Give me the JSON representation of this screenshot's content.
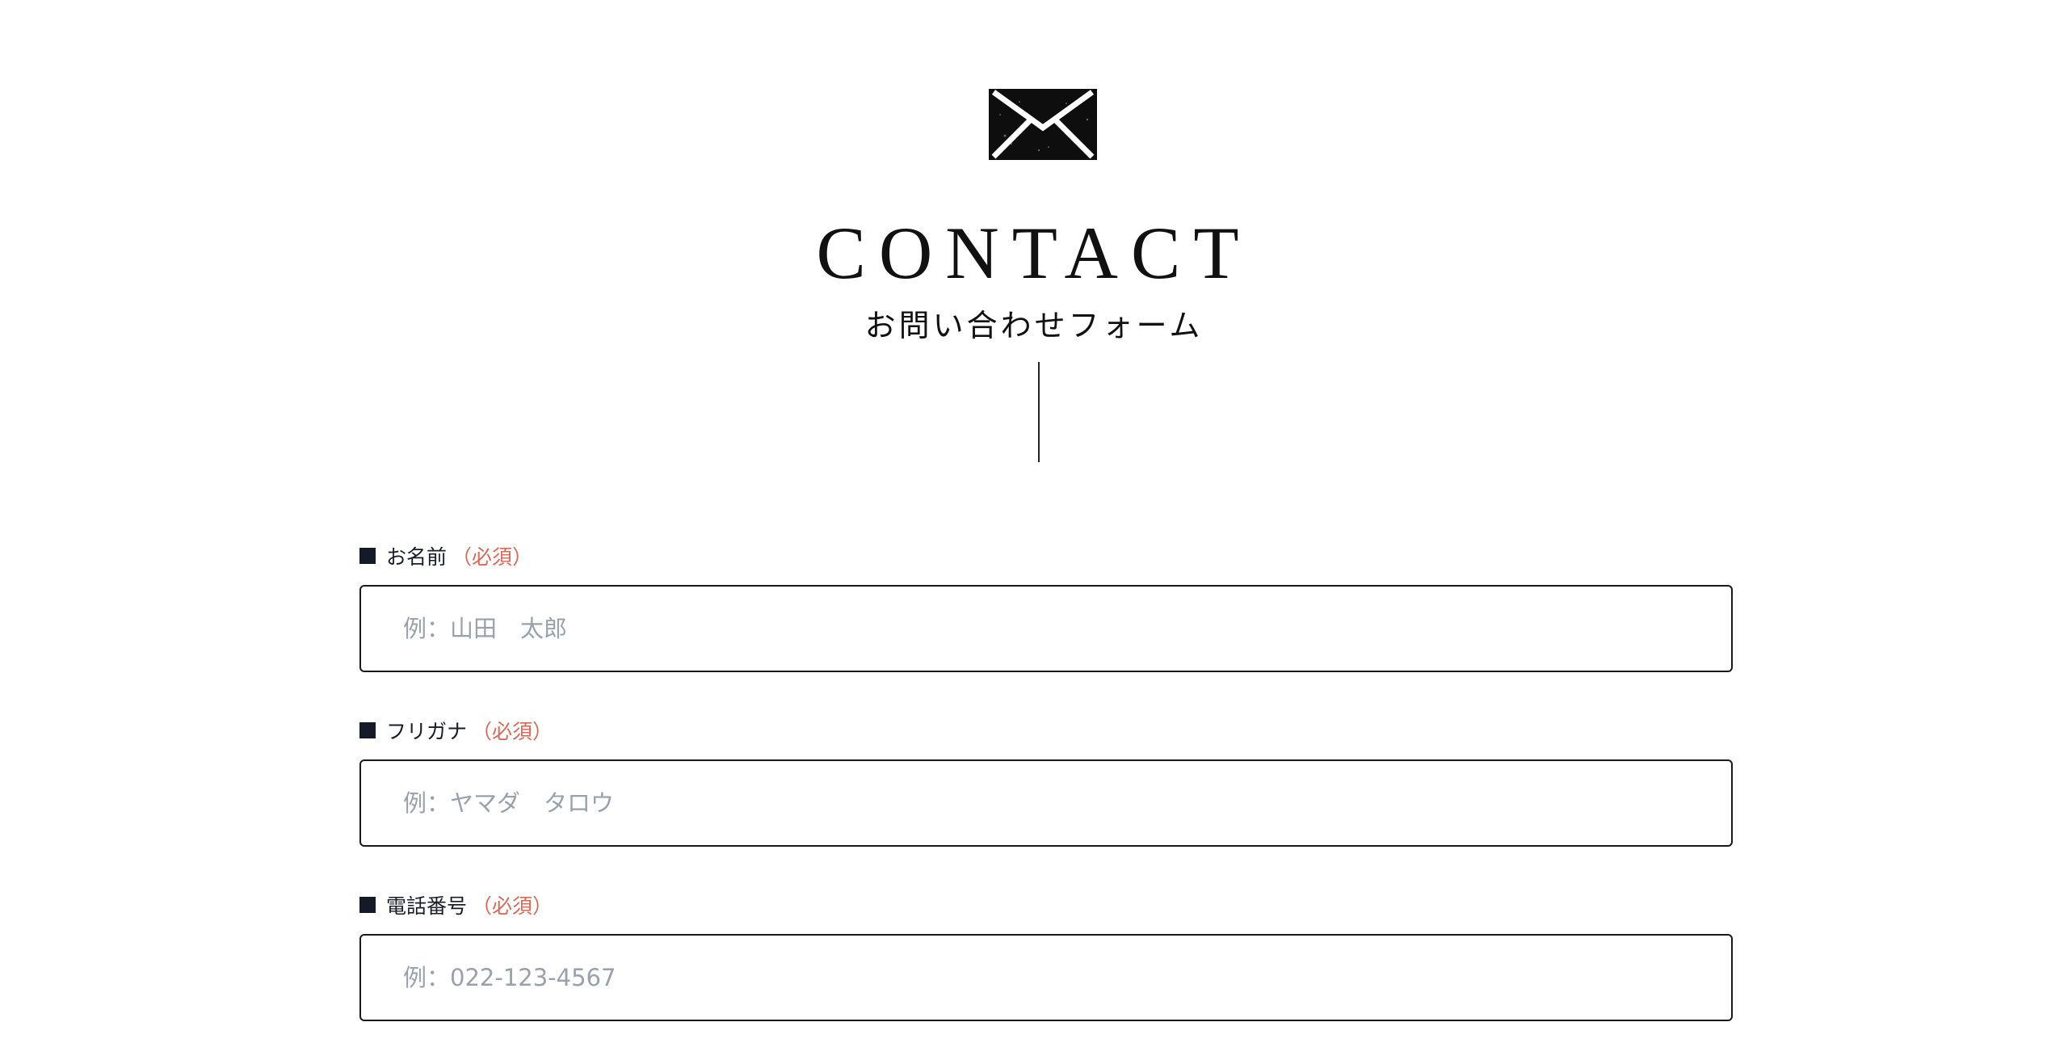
{
  "header": {
    "icon": "envelope-icon",
    "title": "CONTACT",
    "subtitle": "お問い合わせフォーム"
  },
  "form": {
    "fields": [
      {
        "marker": "■",
        "label": "お名前",
        "required": "（必須）",
        "value": "",
        "placeholder": "例：山田　太郎"
      },
      {
        "marker": "■",
        "label": "フリガナ",
        "required": "（必須）",
        "value": "",
        "placeholder": "例：ヤマダ　タロウ"
      },
      {
        "marker": "■",
        "label": "電話番号",
        "required": "（必須）",
        "value": "",
        "placeholder": "例：022-123-4567"
      }
    ]
  },
  "colors": {
    "text": "#111111",
    "required": "#d36b5b",
    "placeholder": "#9aa1ad",
    "border": "#1a1a1a",
    "marker": "#141a28"
  }
}
